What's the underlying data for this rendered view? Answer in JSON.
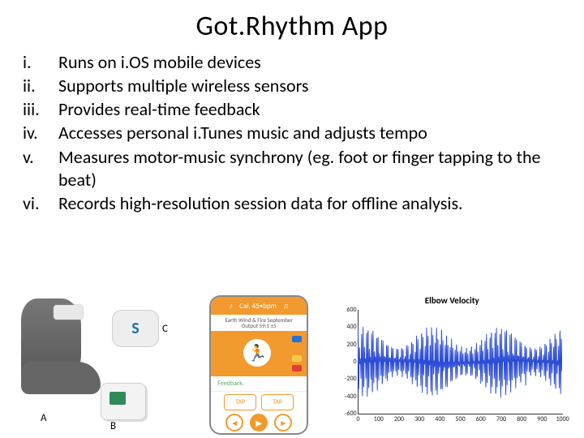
{
  "title": "Got.Rhythm App",
  "items": [
    {
      "num": "i.",
      "text": "Runs on i.OS mobile devices"
    },
    {
      "num": "ii.",
      "text": "Supports multiple wireless sensors"
    },
    {
      "num": "iii.",
      "text": "Provides real-time feedback"
    },
    {
      "num": "iv.",
      "text": "Accesses personal i.Tunes music and adjusts tempo"
    },
    {
      "num": "v.",
      "text": "Measures motor-music synchrony (eg. foot or finger tapping to the beat)"
    },
    {
      "num": "vi.",
      "text": "Records high-resolution session  data for offline analysis."
    }
  ],
  "panelA": {
    "labels": {
      "A": "A",
      "B": "B",
      "C": "C"
    },
    "chipC_glyph": "S"
  },
  "panelB": {
    "header": "Cal. 45•bpm",
    "cadence_line": "Earth Wind & Fire September",
    "output_line": "Output 59:1 ±5",
    "feedback_label": "Feedback:",
    "tap_label": "TAP",
    "dial_colors": [
      "#2a6fd6",
      "#f29a2e",
      "#f2c84b",
      "#e23b3b"
    ]
  },
  "chart_data": {
    "type": "line",
    "title": "Elbow Velocity",
    "xlabel": "",
    "ylabel": "",
    "xlim": [
      0,
      1000
    ],
    "ylim": [
      -600,
      600
    ],
    "xticks": [
      0,
      100,
      200,
      300,
      400,
      500,
      600,
      700,
      800,
      900,
      1000
    ],
    "yticks": [
      -600,
      -400,
      -200,
      0,
      200,
      400,
      600
    ],
    "n_points": 1000,
    "note": "dense oscillatory signal roughly within ±450 with occasional spikes near ±550",
    "series": [
      {
        "name": "elbow_velocity",
        "amplitude_typical": 420,
        "amplitude_peak": 560,
        "color": "#2a4bd6"
      }
    ]
  }
}
